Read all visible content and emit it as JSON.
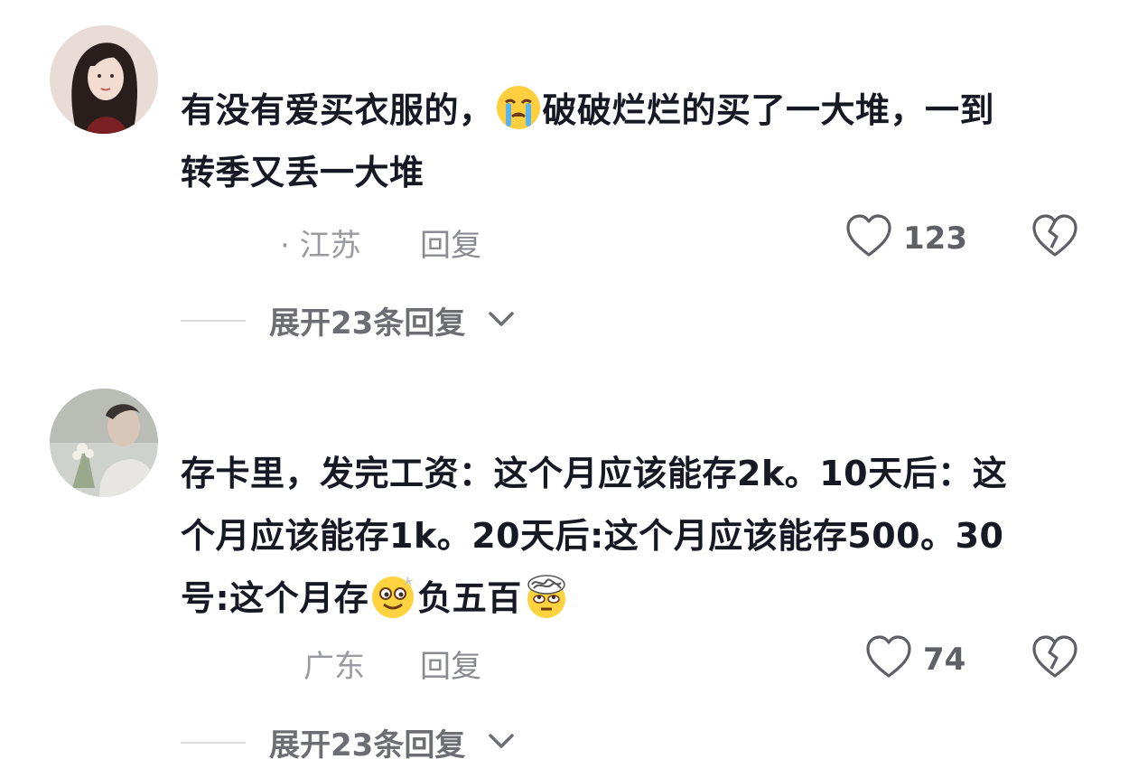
{
  "comments": [
    {
      "text_before_emoji": "有没有爱买衣服的，",
      "emoji_icon": "crying-face",
      "text_line1_after": "破破烂烂的买了一大堆，一到",
      "text_line2": "转季又丢一大堆",
      "location": "· 江苏",
      "reply_label": "回复",
      "like_count": "123",
      "expand_label": "展开23条回复"
    },
    {
      "text_line1": "存卡里，发完工资：这个月应该能存2k。10天后：这",
      "text_line2": "个月应该能存1k。20天后:这个月应该能存500。30",
      "text_line3_a": "号:这个月存",
      "emoji_a": "dizzy-smile-face",
      "text_line3_b": "负五百",
      "emoji_b": "confused-dizzy-face",
      "location": "广东",
      "reply_label": "回复",
      "like_count": "74",
      "expand_label": "展开23条回复"
    }
  ],
  "colors": {
    "text": "#161823",
    "secondary": "#9a9ba1",
    "expand": "#6d6e74"
  }
}
